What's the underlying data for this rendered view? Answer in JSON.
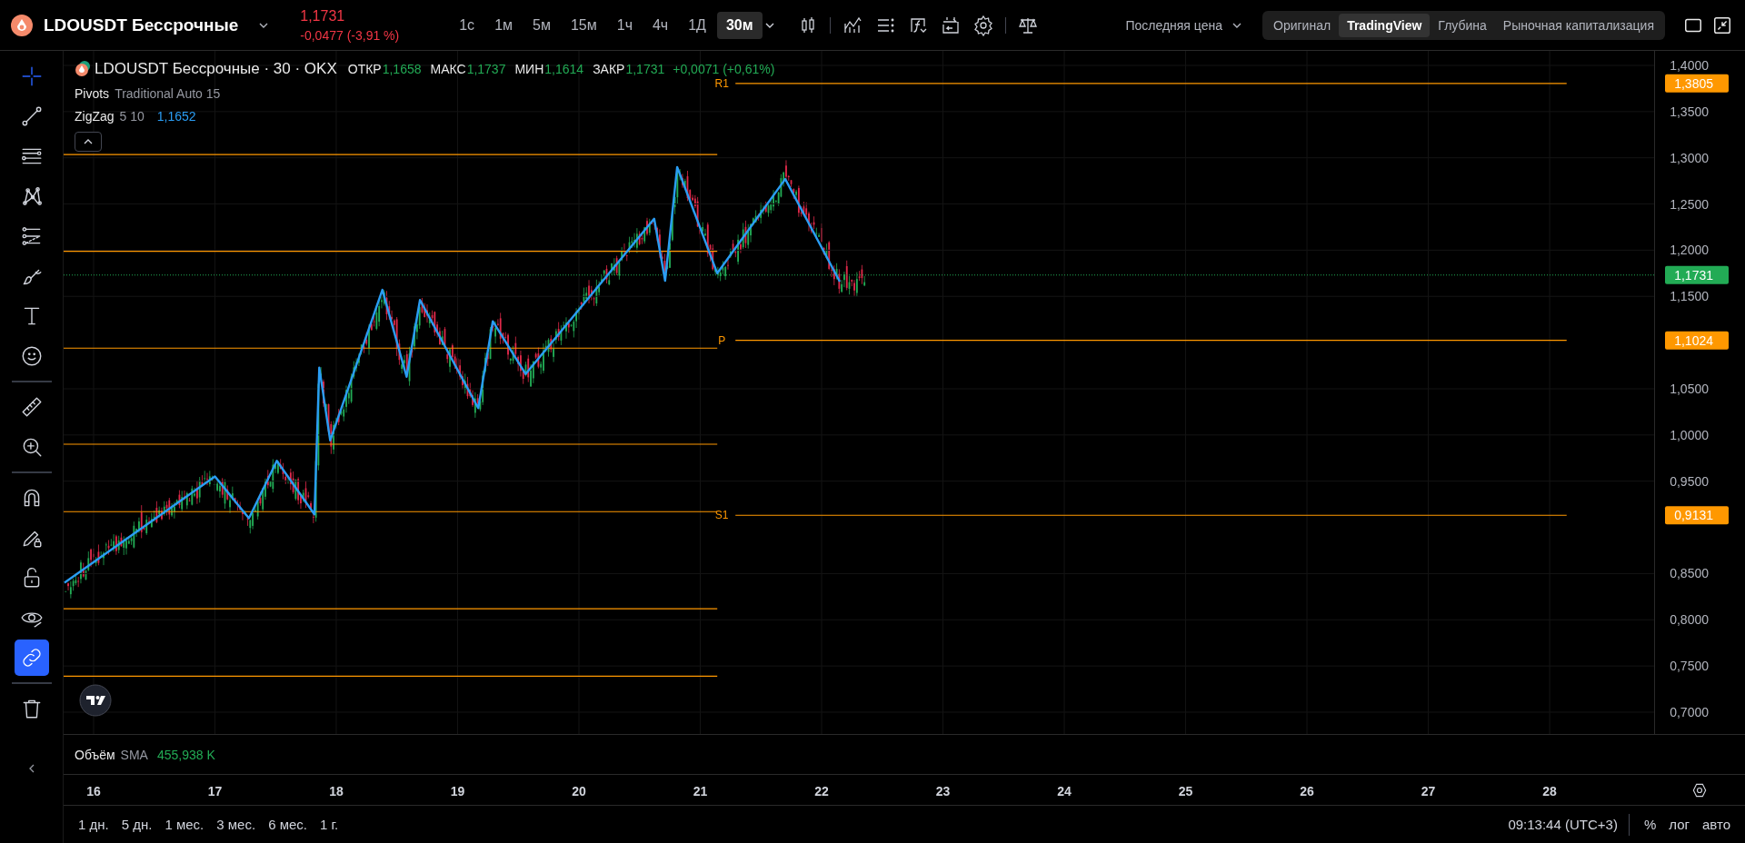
{
  "header": {
    "symbol": "LDOUSDT Бессрочные",
    "price": "1,1731",
    "change": "-0,0477 (-3,91 %)",
    "intervals": [
      {
        "label": "1с",
        "selected": false
      },
      {
        "label": "1м",
        "selected": false
      },
      {
        "label": "5м",
        "selected": false
      },
      {
        "label": "15м",
        "selected": false
      },
      {
        "label": "1ч",
        "selected": false
      },
      {
        "label": "4ч",
        "selected": false
      },
      {
        "label": "1Д",
        "selected": false
      },
      {
        "label": "30м",
        "selected": true
      }
    ],
    "price_source": "Последняя цена",
    "views": [
      {
        "label": "Оригинал",
        "selected": false
      },
      {
        "label": "TradingView",
        "selected": true
      },
      {
        "label": "Глубина",
        "selected": false
      },
      {
        "label": "Рыночная капитализация",
        "selected": false
      }
    ]
  },
  "toolbar": {
    "tools": [
      {
        "kind": "crosshair",
        "selected": true
      },
      {
        "kind": "line",
        "selected": false
      },
      {
        "kind": "hlines",
        "selected": false
      },
      {
        "kind": "pattern",
        "selected": false
      },
      {
        "kind": "fib",
        "selected": false
      },
      {
        "kind": "brush",
        "selected": false
      },
      {
        "kind": "text",
        "selected": false
      },
      {
        "kind": "smiley",
        "selected": false
      },
      {
        "kind": "separator"
      },
      {
        "kind": "ruler",
        "selected": false
      },
      {
        "kind": "zoom",
        "selected": false
      },
      {
        "kind": "separator"
      },
      {
        "kind": "magnet",
        "selected": false
      },
      {
        "kind": "pencillock",
        "selected": false
      },
      {
        "kind": "lock",
        "selected": false
      },
      {
        "kind": "eye",
        "selected": false
      },
      {
        "kind": "link",
        "selected": true
      },
      {
        "kind": "separator"
      },
      {
        "kind": "trash",
        "selected": false
      }
    ]
  },
  "legend": {
    "title": "LDOUSDT Бессрочные · 30 · OKX",
    "ohlc": [
      {
        "label": "ОТКР",
        "value": "1,1658"
      },
      {
        "label": "МАКС",
        "value": "1,1737"
      },
      {
        "label": "МИН",
        "value": "1,1614"
      },
      {
        "label": "ЗАКР",
        "value": "1,1731"
      }
    ],
    "change": "+0,0071 (+0,61%)",
    "pivots": {
      "name": "Pivots",
      "params": "Traditional Auto 15"
    },
    "zigzag": {
      "name": "ZigZag",
      "params": "5 10",
      "value": "1,1652"
    }
  },
  "price_levels": [
    {
      "kind": "pivot",
      "tag": "1,3805"
    },
    {
      "kind": "last",
      "tag": "1,1731"
    },
    {
      "kind": "pivot",
      "tag": "1,1024"
    },
    {
      "kind": "pivot",
      "tag": "0,9131"
    }
  ],
  "chart_data": {
    "type": "line",
    "grid": true,
    "xlim": [
      15.753,
      29.61
    ],
    "ylim": [
      0.6764,
      1.4157
    ],
    "x": [
      15.76,
      17.0,
      17.28,
      17.51,
      17.82,
      17.86,
      17.95,
      18.38,
      18.58,
      18.69,
      19.17,
      19.29,
      19.56,
      20.62,
      20.71,
      20.81,
      21.14,
      21.7,
      22.15
    ],
    "series": [
      {
        "color": "#2a9df4",
        "values": [
          0.84,
          0.955,
          0.91,
          0.972,
          0.914,
          1.073,
          0.994,
          1.157,
          1.063,
          1.146,
          1.029,
          1.123,
          1.066,
          1.234,
          1.167,
          1.29,
          1.175,
          1.277,
          1.166
        ]
      }
    ],
    "xticks": [
      {
        "value": 16,
        "label": "16"
      },
      {
        "value": 17,
        "label": "17"
      },
      {
        "value": 18,
        "label": "18"
      },
      {
        "value": 19,
        "label": "19"
      },
      {
        "value": 20,
        "label": "20"
      },
      {
        "value": 21,
        "label": "21"
      },
      {
        "value": 22,
        "label": "22"
      },
      {
        "value": 23,
        "label": "23"
      },
      {
        "value": 24,
        "label": "24"
      },
      {
        "value": 25,
        "label": "25"
      },
      {
        "value": 26,
        "label": "26"
      },
      {
        "value": 27,
        "label": "27"
      },
      {
        "value": 28,
        "label": "28"
      }
    ],
    "yticks": [
      {
        "value": 1.4,
        "label": "1,4000"
      },
      {
        "value": 1.35,
        "label": "1,3500"
      },
      {
        "value": 1.3,
        "label": "1,3000"
      },
      {
        "value": 1.25,
        "label": "1,2500"
      },
      {
        "value": 1.2,
        "label": "1,2000"
      },
      {
        "value": 1.15,
        "label": "1,1500"
      },
      {
        "value": 1.05,
        "label": "1,0500"
      },
      {
        "value": 1.0,
        "label": "1,0000"
      },
      {
        "value": 0.95,
        "label": "0,9500"
      },
      {
        "value": 0.85,
        "label": "0,8500"
      },
      {
        "value": 0.8,
        "label": "0,8000"
      },
      {
        "value": 0.75,
        "label": "0,7500"
      },
      {
        "value": 0.7,
        "label": "0,7000"
      }
    ],
    "ref_lines": [
      {
        "axis": "y",
        "value": 1.3805,
        "label": "R1"
      },
      {
        "axis": "y",
        "value": 1.3036
      },
      {
        "axis": "y",
        "value": 1.1988
      },
      {
        "axis": "y",
        "value": 1.1731
      },
      {
        "axis": "y",
        "value": 1.1024,
        "label": "P"
      },
      {
        "axis": "y",
        "value": 1.094
      },
      {
        "axis": "y",
        "value": 0.99
      },
      {
        "axis": "y",
        "value": 0.9131,
        "label": "S1"
      },
      {
        "axis": "y",
        "value": 0.917
      },
      {
        "axis": "y",
        "value": 0.812
      },
      {
        "axis": "y",
        "value": 0.739
      }
    ]
  },
  "volume": {
    "name": "Объём",
    "params": "SMA",
    "value": "455,938 K"
  },
  "footer": {
    "ranges": [
      "1 дн.",
      "5 дн.",
      "1 мес.",
      "3 мес.",
      "6 мес.",
      "1 г."
    ],
    "time": "09:13:44 (UTC+3)",
    "scales": [
      "%",
      "лог",
      "авто"
    ]
  }
}
